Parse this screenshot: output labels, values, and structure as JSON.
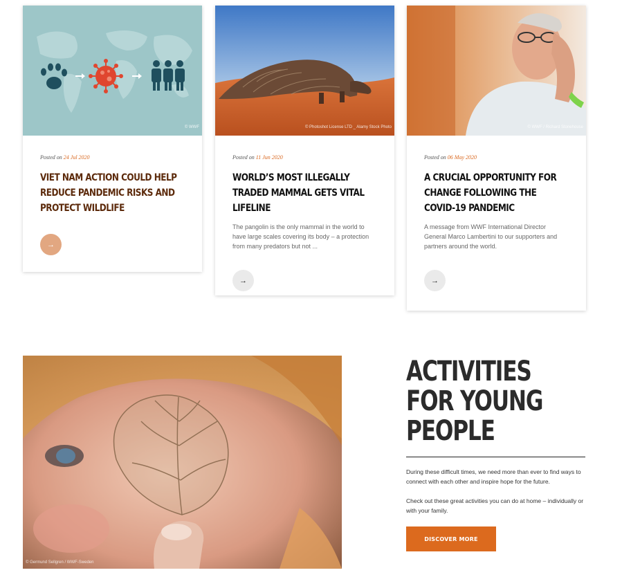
{
  "cards": [
    {
      "posted_prefix": "Posted on",
      "date": "24 Jul 2020",
      "title": "Viet Nam action could help reduce pandemic risks and protect wildlife",
      "excerpt": "",
      "image_credit": "© WWF",
      "arrow": "→"
    },
    {
      "posted_prefix": "Posted on",
      "date": "11 Jun 2020",
      "title": "World’s most illegally traded mammal gets vital lifeline",
      "excerpt": "The pangolin is the only mammal in the world to have large scales covering its body – a protection from many predators but not ...",
      "image_credit": "© Photoshot License LTD _ Alamy Stock Photo",
      "arrow": "→"
    },
    {
      "posted_prefix": "Posted on",
      "date": "06 May 2020",
      "title": "A crucial opportunity for change following the COVID-19 pandemic",
      "excerpt": "A message from WWF International Director General Marco Lambertini to our supporters and partners around the world.",
      "image_credit": "© WWF / Richard Stonehouse",
      "arrow": "→"
    }
  ],
  "activities": {
    "title": "Activities for young people",
    "paragraph_1": "During these difficult times, we need more than ever to find ways to connect with each other and inspire hope for the future.",
    "paragraph_2": "Check out these great activities you can do at home – individually or with your family.",
    "button_label": "DISCOVER MORE",
    "photo_credit": "© Germund Sellgren / WWF-Sweden"
  },
  "colors": {
    "accent_orange": "#dc6a1e",
    "title_brown": "#5c2a0b",
    "card1_image_bg": "#9dc6c8",
    "arrow_orange_bg": "#e2a781"
  }
}
